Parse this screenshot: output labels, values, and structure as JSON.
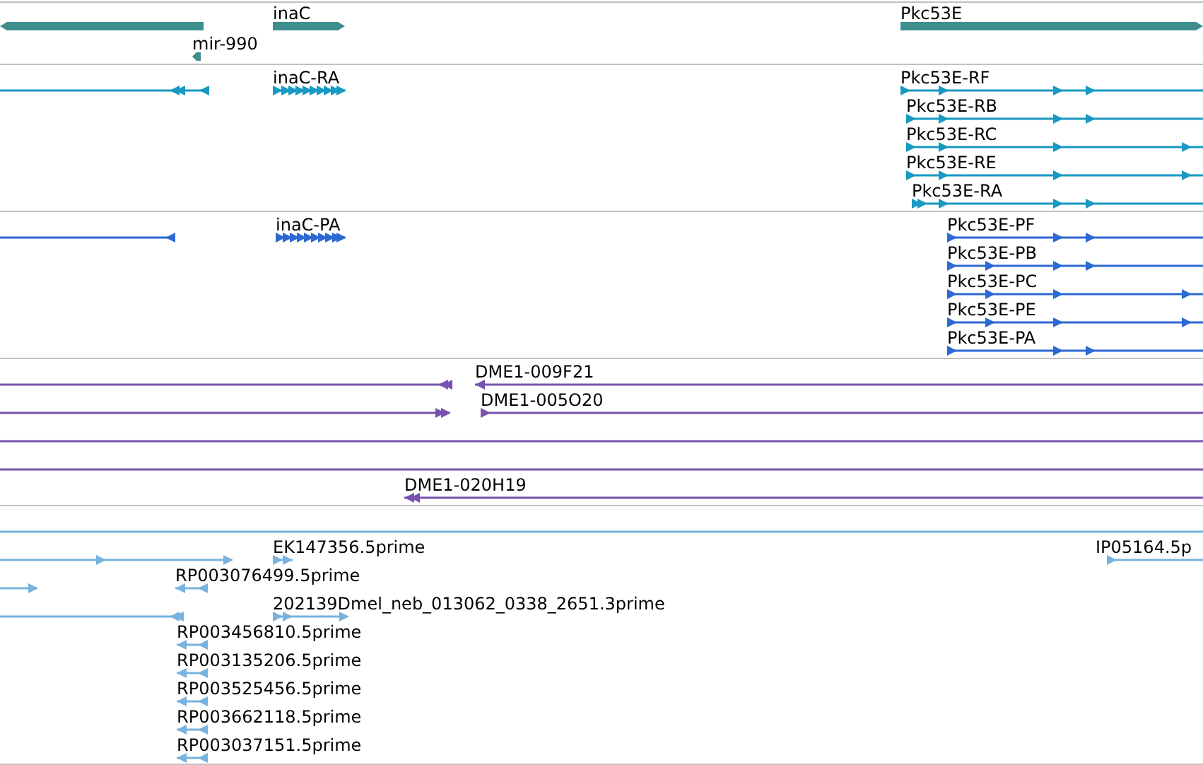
{
  "tracks": [
    {
      "color": "#3e8e8e",
      "features": [
        {
          "kind": "gene",
          "reverse": true
        },
        {
          "kind": "gene",
          "label": "inaC",
          "reverse": false
        },
        {
          "kind": "gene",
          "label": "mir-990",
          "reverse": true
        },
        {
          "kind": "gene",
          "label": "Pkc53E",
          "reverse": false
        }
      ]
    },
    {
      "color": "#1799c2",
      "features": [
        {
          "kind": "transcript",
          "reverse": true
        },
        {
          "kind": "transcript",
          "label": "inaC-RA",
          "reverse": false
        },
        {
          "kind": "transcript",
          "label": "Pkc53E-RF",
          "reverse": false
        },
        {
          "kind": "transcript",
          "label": "Pkc53E-RB",
          "reverse": false
        },
        {
          "kind": "transcript",
          "label": "Pkc53E-RC",
          "reverse": false
        },
        {
          "kind": "transcript",
          "label": "Pkc53E-RE",
          "reverse": false
        },
        {
          "kind": "transcript",
          "label": "Pkc53E-RA",
          "reverse": false
        }
      ]
    },
    {
      "color": "#2c69d2",
      "features": [
        {
          "kind": "transcript",
          "reverse": true
        },
        {
          "kind": "transcript",
          "label": "inaC-PA",
          "reverse": false
        },
        {
          "kind": "transcript",
          "label": "Pkc53E-PF",
          "reverse": false
        },
        {
          "kind": "transcript",
          "label": "Pkc53E-PB",
          "reverse": false
        },
        {
          "kind": "transcript",
          "label": "Pkc53E-PC",
          "reverse": false
        },
        {
          "kind": "transcript",
          "label": "Pkc53E-PE",
          "reverse": false
        },
        {
          "kind": "transcript",
          "label": "Pkc53E-PA",
          "reverse": false
        }
      ]
    },
    {
      "color": "#7752b0",
      "features": [
        {
          "kind": "transcript",
          "reverse": true
        },
        {
          "kind": "transcript",
          "label": "DME1-009F21",
          "reverse": true
        },
        {
          "kind": "transcript",
          "reverse": false
        },
        {
          "kind": "transcript",
          "label": "DME1-005O20",
          "reverse": false
        },
        {
          "kind": "transcript"
        },
        {
          "kind": "transcript"
        },
        {
          "kind": "transcript",
          "label": "DME1-020H19",
          "reverse": true
        }
      ]
    },
    {
      "color": "#78b2de",
      "features": [
        {
          "kind": "transcript"
        },
        {
          "kind": "transcript",
          "reverse": false
        },
        {
          "kind": "transcript",
          "label": "EK147356.5prime",
          "reverse": false
        },
        {
          "kind": "transcript",
          "label": "IP05164.5p",
          "reverse": false
        },
        {
          "kind": "transcript",
          "reverse": false
        },
        {
          "kind": "transcript",
          "label": "RP003076499.5prime",
          "reverse": true
        },
        {
          "kind": "transcript",
          "reverse": true
        },
        {
          "kind": "transcript",
          "label": "202139Dmel_neb_013062_0338_2651.3prime",
          "reverse": false
        },
        {
          "kind": "transcript",
          "label": "RP003456810.5prime",
          "reverse": true
        },
        {
          "kind": "transcript",
          "label": "RP003135206.5prime",
          "reverse": true
        },
        {
          "kind": "transcript",
          "label": "RP003525456.5prime",
          "reverse": true
        },
        {
          "kind": "transcript",
          "label": "RP003662118.5prime",
          "reverse": true
        },
        {
          "kind": "transcript",
          "label": "RP003037151.5prime",
          "reverse": true
        }
      ]
    }
  ]
}
